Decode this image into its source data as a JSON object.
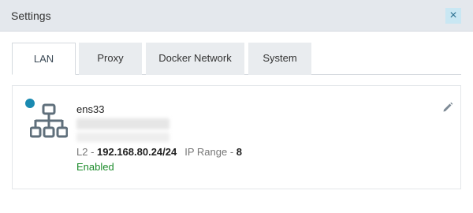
{
  "window": {
    "title": "Settings",
    "close_glyph": "×"
  },
  "tabs": [
    {
      "label": "LAN",
      "active": true
    },
    {
      "label": "Proxy",
      "active": false
    },
    {
      "label": "Docker Network",
      "active": false
    },
    {
      "label": "System",
      "active": false
    }
  ],
  "interface": {
    "name": "ens33",
    "layer_label": "L2 - ",
    "address": "192.168.80.24/24",
    "ip_range_label": "IP Range - ",
    "ip_range": "8",
    "status": "Enabled",
    "status_color": "#1b8b2a",
    "indicator_color": "#1a8ab1",
    "icon": "network-topology-icon",
    "edit_icon": "pencil-icon"
  }
}
